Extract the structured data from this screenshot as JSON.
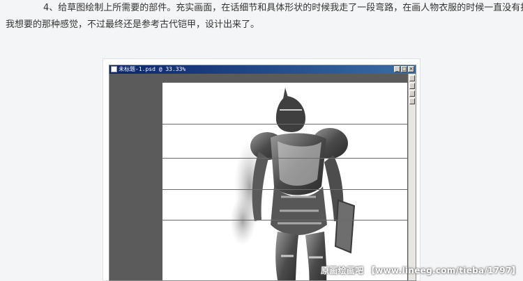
{
  "article": {
    "line1": "4、给草图绘制上所需要的部件。充实画面，在话细节和具体形状的时候我走了一段弯路，在画人物衣服的时候一直没有找到",
    "line2": "我想要的那种感觉，不过最终还是参考古代铠甲，设计出来了。"
  },
  "window": {
    "title": "未标题-1.psd @ 33.33%",
    "minimize": "_",
    "maximize": "□",
    "close": "×"
  },
  "watermark": {
    "text": "原画绘画吧 【www.lineeg.com/tieba/1797】"
  },
  "colors": {
    "titlebar_start": "#0a246a",
    "titlebar_end": "#3a6ea5",
    "workspace": "#5b5b5b",
    "canvas": "#ffffff",
    "page_bg": "#f4f5f6"
  },
  "image": {
    "subject": "armored-knight-sketch"
  }
}
